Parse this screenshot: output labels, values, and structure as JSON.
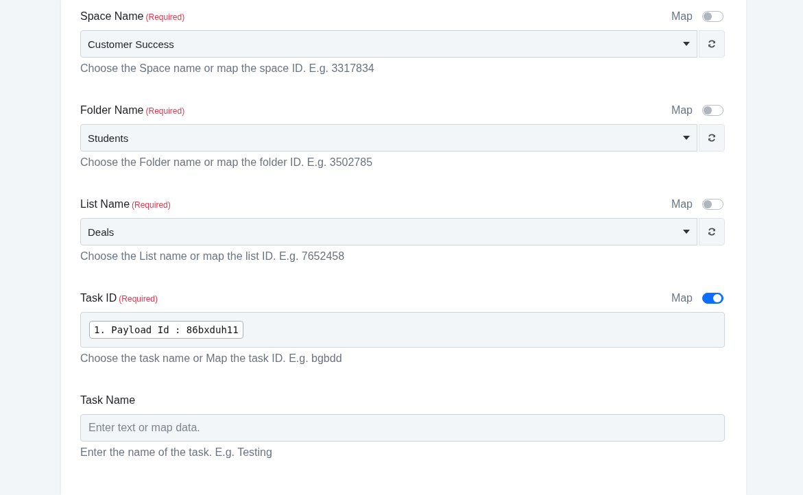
{
  "fields": [
    {
      "kind": "select",
      "label": "Space Name",
      "required": "(Required)",
      "map_label": "Map",
      "map_on": false,
      "value": "Customer Success",
      "help": "Choose the Space name or map the space ID. E.g. 3317834"
    },
    {
      "kind": "select",
      "label": "Folder Name",
      "required": "(Required)",
      "map_label": "Map",
      "map_on": false,
      "value": "Students",
      "help": "Choose the Folder name or map the folder ID. E.g. 3502785"
    },
    {
      "kind": "select",
      "label": "List Name",
      "required": "(Required)",
      "map_label": "Map",
      "map_on": false,
      "value": "Deals",
      "help": "Choose the List name or map the list ID. E.g. 7652458"
    },
    {
      "kind": "mapped",
      "label": "Task ID",
      "required": "(Required)",
      "map_label": "Map",
      "map_on": true,
      "tokens": [
        "1. Payload Id : 86bxduh11"
      ],
      "help": "Choose the task name or Map the task ID. E.g. bgbdd"
    },
    {
      "kind": "text",
      "label": "Task Name",
      "placeholder": "Enter text or map data.",
      "help": "Enter the name of the task. E.g. Testing"
    }
  ]
}
